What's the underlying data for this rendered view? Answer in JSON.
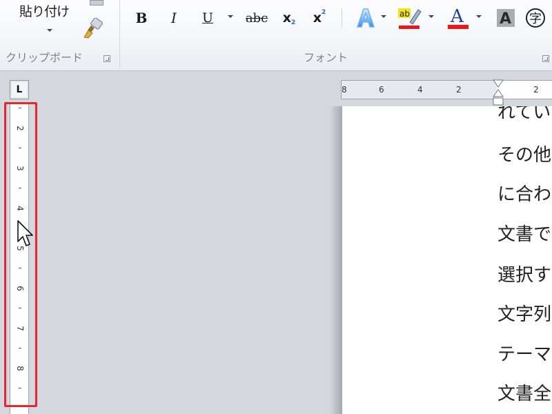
{
  "ribbon": {
    "clipboard_group": {
      "paste_label": "貼り付け",
      "group_label": "クリップボード"
    },
    "font_group": {
      "group_label": "フォント",
      "bold": "B",
      "italic": "I",
      "underline": "U",
      "strikethrough": "abc",
      "subscript": "x",
      "subscript_mark": "2",
      "superscript": "x",
      "superscript_mark": "2",
      "highlight_text": "ab",
      "font_color_letter": "A",
      "shading_letter": "A",
      "enclose_char": "字"
    }
  },
  "ruler": {
    "corner_label": "L",
    "vertical_numbers": [
      "2",
      "3",
      "4",
      "5",
      "6",
      "7",
      "8"
    ],
    "horizontal_numbers": [
      "8",
      "6",
      "4",
      "2",
      "2"
    ]
  },
  "document": {
    "lines": [
      "れてい",
      "その他",
      "に合わ",
      "文書で",
      "選択す",
      "文字列",
      "テーマ",
      "文書全"
    ]
  },
  "colors": {
    "highlight_box": "#e8272b",
    "font_color_bar": "#e8151b",
    "highlight_marker": "#f3e51a"
  },
  "icons": [
    "format-painter-icon",
    "text-effects-icon",
    "highlight-icon",
    "font-color-icon",
    "shading-icon",
    "enclose-icon",
    "mouse-pointer-icon"
  ]
}
